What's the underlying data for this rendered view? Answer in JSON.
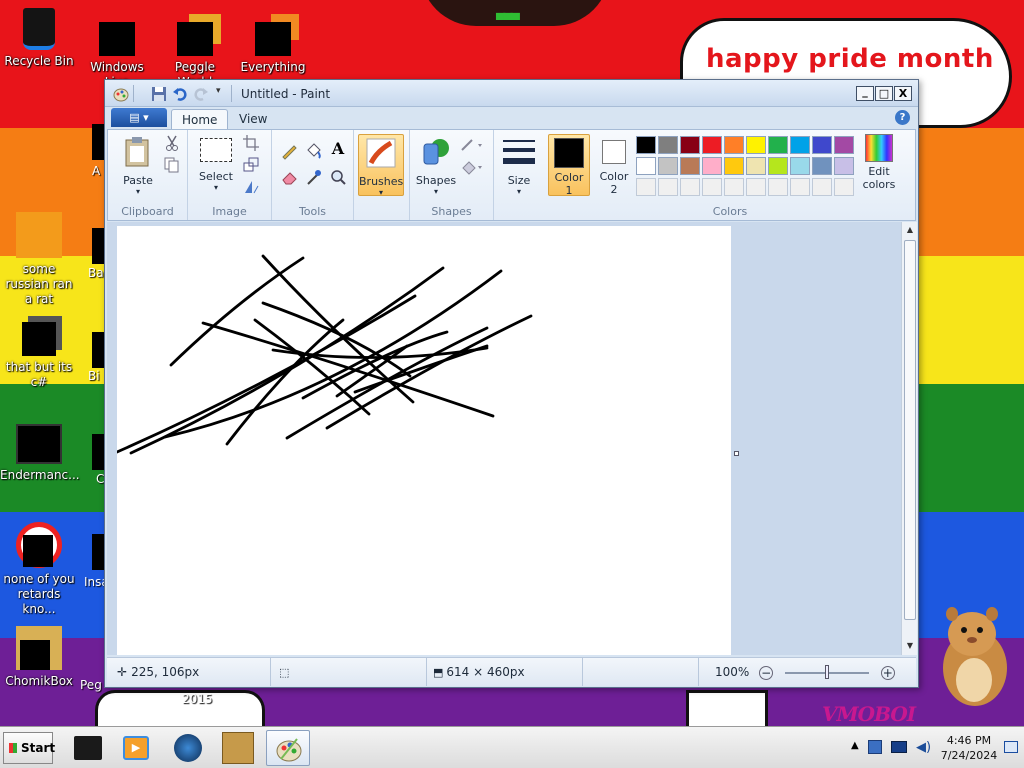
{
  "wallpaper": {
    "stripes": [
      "#e8141a",
      "#f57d14",
      "#f7e51a",
      "#1b8a26",
      "#1d58e0",
      "#6e1f96"
    ],
    "speech_text": "happy pride month",
    "watermark": "VMOBOI"
  },
  "desktop_icons": [
    {
      "label": "Recycle Bin",
      "icon": "recycle-bin-icon"
    },
    {
      "label": "Windows Live",
      "icon": "windows-live-icon"
    },
    {
      "label": "Peggle World",
      "icon": "peggle-icon"
    },
    {
      "label": "Everything",
      "icon": "everything-search-icon"
    },
    {
      "label": "some russian ran a rat",
      "icon": "app-icon"
    },
    {
      "label": "that but its c#",
      "icon": "app-icon"
    },
    {
      "label": "Endermanc...",
      "icon": "app-icon"
    },
    {
      "label": "none of you retards kno...",
      "icon": "app-icon"
    },
    {
      "label": "ChomikBox",
      "icon": "chomikbox-icon"
    }
  ],
  "desktop_peek_labels": [
    "A",
    "Ba",
    "Bi",
    "C",
    "Insa",
    "Peg"
  ],
  "desktop_year": "2015",
  "paint": {
    "title": "Untitled - Paint",
    "window_buttons": {
      "minimize": "_",
      "maximize": "□",
      "close": "X"
    },
    "tabs": [
      {
        "label": "Home",
        "active": true
      },
      {
        "label": "View",
        "active": false
      }
    ],
    "groups": {
      "clipboard": {
        "label": "Clipboard",
        "paste": "Paste"
      },
      "image": {
        "label": "Image",
        "select": "Select"
      },
      "tools": {
        "label": "Tools"
      },
      "brushes": {
        "label": "Brushes"
      },
      "shapes": {
        "label": "Shapes",
        "button": "Shapes"
      },
      "size": {
        "label": "Size"
      },
      "colors": {
        "label": "Colors",
        "color1": "Color\n1",
        "color1_line1": "Color",
        "color1_line2": "1",
        "color2_line1": "Color",
        "color2_line2": "2",
        "edit_line1": "Edit",
        "edit_line2": "colors"
      }
    },
    "palette_row1": [
      "#000000",
      "#7f7f7f",
      "#880015",
      "#ed1c24",
      "#ff7f27",
      "#fff200",
      "#22b14c",
      "#00a2e8",
      "#3f48cc",
      "#a349a4"
    ],
    "palette_row2": [
      "#ffffff",
      "#c3c3c3",
      "#b97a57",
      "#ffaec9",
      "#ffc90e",
      "#efe4b0",
      "#b5e61d",
      "#99d9ea",
      "#7092be",
      "#c8bfe7"
    ],
    "palette_row3": [
      "#f0f0f0",
      "#f0f0f0",
      "#f0f0f0",
      "#f0f0f0",
      "#f0f0f0",
      "#f0f0f0",
      "#f0f0f0",
      "#f0f0f0",
      "#f0f0f0",
      "#f0f0f0"
    ],
    "color1": "#000000",
    "color2": "#ffffff",
    "status": {
      "cursor_pos": "225, 106px",
      "canvas_size": "614 × 460px",
      "zoom": "100%"
    }
  },
  "taskbar": {
    "start_label": "Start",
    "time": "4:46 PM",
    "date": "7/24/2024"
  }
}
